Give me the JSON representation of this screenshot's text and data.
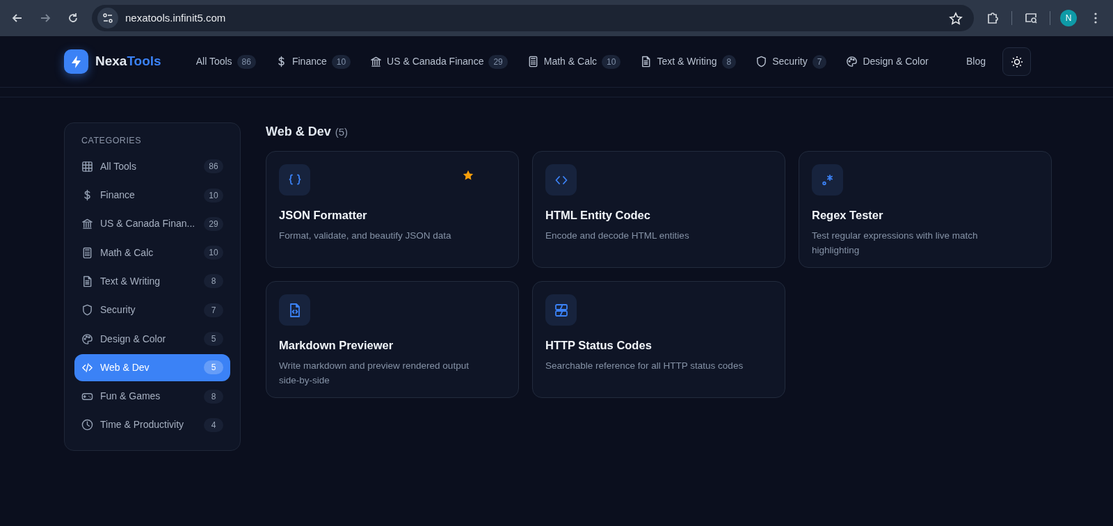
{
  "browser": {
    "url": "nexatools.infinit5.com",
    "avatar": "N",
    "bookmarked": false
  },
  "brand": {
    "part_1": "Nexa",
    "part_2": "Tools"
  },
  "nav": [
    {
      "label": "All Tools",
      "count": "86"
    },
    {
      "label": "Finance",
      "count": "10"
    },
    {
      "label": "US & Canada Finance",
      "count": "29"
    },
    {
      "label": "Math & Calc",
      "count": "10"
    },
    {
      "label": "Text & Writing",
      "count": "8"
    },
    {
      "label": "Security",
      "count": "7"
    },
    {
      "label": "Design & Color"
    }
  ],
  "blog": "Blog",
  "sidebar": {
    "title": "CATEGORIES",
    "items": [
      {
        "label": "All Tools",
        "count": "86",
        "selected": false
      },
      {
        "label": "Finance",
        "count": "10",
        "selected": false
      },
      {
        "label": "US & Canada Finan...",
        "count": "29",
        "selected": false
      },
      {
        "label": "Math & Calc",
        "count": "10",
        "selected": false
      },
      {
        "label": "Text & Writing",
        "count": "8",
        "selected": false
      },
      {
        "label": "Security",
        "count": "7",
        "selected": false
      },
      {
        "label": "Design & Color",
        "count": "5",
        "selected": false
      },
      {
        "label": "Web & Dev",
        "count": "5",
        "selected": true
      },
      {
        "label": "Fun & Games",
        "count": "8",
        "selected": false
      },
      {
        "label": "Time & Productivity",
        "count": "4",
        "selected": false
      }
    ]
  },
  "section": {
    "title": "Web & Dev",
    "count": "(5)"
  },
  "tools": [
    {
      "name": "JSON Formatter",
      "description": "Format, validate, and beautify JSON data",
      "favorite": true
    },
    {
      "name": "HTML Entity Codec",
      "description": "Encode and decode HTML entities",
      "favorite": false
    },
    {
      "name": "Regex Tester",
      "description": "Test regular expressions with live match highlighting",
      "favorite": false
    },
    {
      "name": "Markdown Previewer",
      "description": "Write markdown and preview rendered output side-by-side",
      "favorite": false
    },
    {
      "name": "HTTP Status Codes",
      "description": "Searchable reference for all HTTP status codes",
      "favorite": false
    }
  ]
}
